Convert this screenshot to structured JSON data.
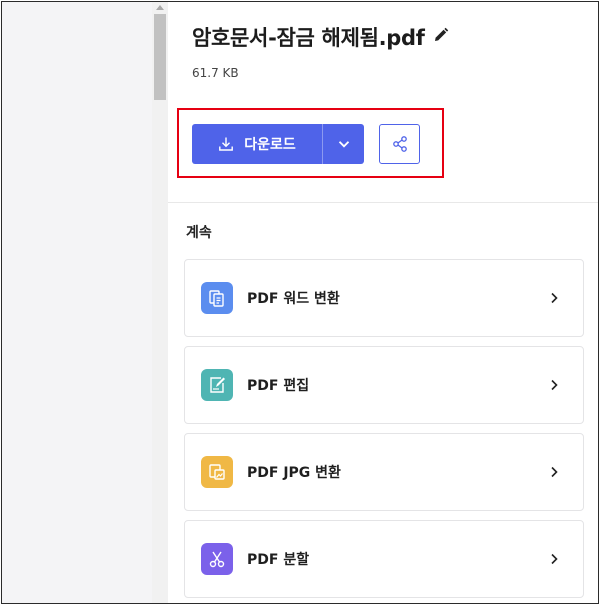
{
  "file": {
    "name": "암호문서-잠금 해제됨.pdf",
    "size": "61.7 KB"
  },
  "actions": {
    "download_label": "다운로드"
  },
  "continue_section": {
    "heading": "계속",
    "tools": [
      {
        "label": "PDF 워드 변환",
        "icon": "pdf-to-word-icon",
        "color": "#5b8def"
      },
      {
        "label": "PDF 편집",
        "icon": "edit-pdf-icon",
        "color": "#4fb5b3"
      },
      {
        "label": "PDF JPG 변환",
        "icon": "pdf-to-jpg-icon",
        "color": "#f0b845"
      },
      {
        "label": "PDF 분할",
        "icon": "split-pdf-icon",
        "color": "#7b61ea"
      }
    ]
  },
  "colors": {
    "accent": "#4f63e9",
    "highlight": "#e60012"
  }
}
